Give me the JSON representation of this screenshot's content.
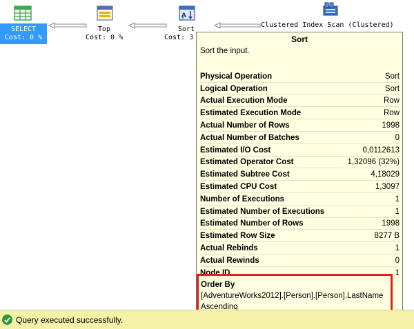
{
  "plan": {
    "select": {
      "name": "SELECT",
      "cost": "Cost: 0 %"
    },
    "top": {
      "name": "Top",
      "cost": "Cost: 0 %"
    },
    "sort": {
      "name": "Sort",
      "cost": "Cost: 3"
    },
    "scan": {
      "name": "Clustered Index Scan (Clustered)"
    }
  },
  "tooltip": {
    "title": "Sort",
    "description": "Sort the input.",
    "rows": [
      {
        "label": "Physical Operation",
        "value": "Sort"
      },
      {
        "label": "Logical Operation",
        "value": "Sort"
      },
      {
        "label": "Actual Execution Mode",
        "value": "Row"
      },
      {
        "label": "Estimated Execution Mode",
        "value": "Row"
      },
      {
        "label": "Actual Number of Rows",
        "value": "1998"
      },
      {
        "label": "Actual Number of Batches",
        "value": "0"
      },
      {
        "label": "Estimated I/O Cost",
        "value": "0,0112613"
      },
      {
        "label": "Estimated Operator Cost",
        "value": "1,32096 (32%)"
      },
      {
        "label": "Estimated Subtree Cost",
        "value": "4,18029"
      },
      {
        "label": "Estimated CPU Cost",
        "value": "1,3097"
      },
      {
        "label": "Number of Executions",
        "value": "1"
      },
      {
        "label": "Estimated Number of Executions",
        "value": "1"
      },
      {
        "label": "Estimated Number of Rows",
        "value": "1998"
      },
      {
        "label": "Estimated Row Size",
        "value": "8277 B"
      },
      {
        "label": "Actual Rebinds",
        "value": "1"
      },
      {
        "label": "Actual Rewinds",
        "value": "0"
      },
      {
        "label": "Node ID",
        "value": "1"
      }
    ],
    "order_by": {
      "heading": "Order By",
      "column": "[AdventureWorks2012].[Person].[Person].LastName",
      "direction": "Ascending"
    }
  },
  "status": {
    "text": "Query executed successfully.",
    "color": "#2f9a38"
  },
  "colors": {
    "selection": "#3399ff",
    "tooltip_bg": "#ffffe1",
    "highlight_border": "#e0211b",
    "statusbar_bg": "#f4f1a9"
  }
}
